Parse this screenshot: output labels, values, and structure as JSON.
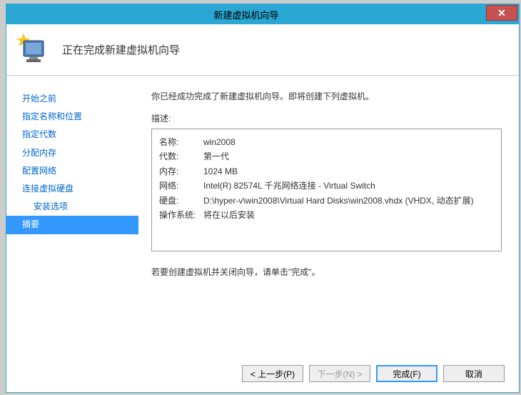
{
  "window": {
    "title": "新建虚拟机向导"
  },
  "header": {
    "title": "正在完成新建虚拟机向导"
  },
  "sidebar": {
    "items": [
      {
        "label": "开始之前",
        "indent": false
      },
      {
        "label": "指定名称和位置",
        "indent": false
      },
      {
        "label": "指定代数",
        "indent": false
      },
      {
        "label": "分配内存",
        "indent": false
      },
      {
        "label": "配置网络",
        "indent": false
      },
      {
        "label": "连接虚拟硬盘",
        "indent": false
      },
      {
        "label": "安装选项",
        "indent": true
      },
      {
        "label": "摘要",
        "indent": false,
        "active": true
      }
    ]
  },
  "main": {
    "intro": "你已经成功完成了新建虚拟机向导。即将创建下列虚拟机。",
    "desc_label": "描述:",
    "summary": [
      {
        "key": "名称:",
        "value": "win2008"
      },
      {
        "key": "代数:",
        "value": "第一代"
      },
      {
        "key": "内存:",
        "value": "1024 MB"
      },
      {
        "key": "网络:",
        "value": "Intel(R) 82574L 千兆网络连接 - Virtual Switch"
      },
      {
        "key": "硬盘:",
        "value": "D:\\hyper-v\\win2008\\Virtual Hard Disks\\win2008.vhdx (VHDX, 动态扩展)"
      },
      {
        "key": "操作系统:",
        "value": "将在以后安装"
      }
    ],
    "hint": "若要创建虚拟机并关闭向导，请单击\"完成\"。"
  },
  "footer": {
    "prev": "< 上一步(P)",
    "next": "下一步(N) >",
    "finish": "完成(F)",
    "cancel": "取消"
  }
}
